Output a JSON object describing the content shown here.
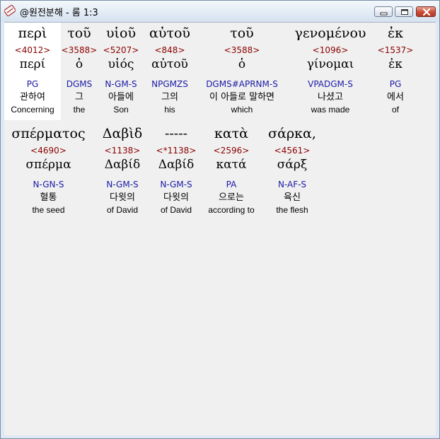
{
  "window": {
    "title": "@원전분해 - 롬 1:3"
  },
  "words_row1": [
    {
      "greek": "περὶ",
      "strong": "<4012>",
      "lemma": "περί",
      "parse": "PG",
      "korean": "관하여",
      "english": "Concerning"
    },
    {
      "greek": "τοῦ",
      "strong": "<3588>",
      "lemma": "ὁ",
      "parse": "DGMS",
      "korean": "그",
      "english": "the"
    },
    {
      "greek": "υἱοῦ",
      "strong": "<5207>",
      "lemma": "υἱός",
      "parse": "N-GM-S",
      "korean": "아들에",
      "english": "Son"
    },
    {
      "greek": "αὐτοῦ",
      "strong": "<848>",
      "lemma": "αὐτοῦ",
      "parse": "NPGMZS",
      "korean": "그의",
      "english": "his"
    },
    {
      "greek": "τοῦ",
      "strong": "<3588>",
      "lemma": "ὁ",
      "parse": "DGMS#APRNM-S",
      "korean": "이 아들로 말하면",
      "english": "which"
    },
    {
      "greek": "γενομένου",
      "strong": "<1096>",
      "lemma": "γίνομαι",
      "parse": "VPADGM-S",
      "korean": "나셨고",
      "english": "was made"
    },
    {
      "greek": "ἐκ",
      "strong": "<1537>",
      "lemma": "ἐκ",
      "parse": "PG",
      "korean": "에서",
      "english": "of"
    }
  ],
  "words_row2": [
    {
      "greek": "σπέρματος",
      "strong": "<4690>",
      "lemma": "σπέρμα",
      "parse": "N-GN-S",
      "korean": "혈통",
      "english": "the seed"
    },
    {
      "greek": "Δαβὶδ",
      "strong": "<1138>",
      "lemma": "Δαβίδ",
      "parse": "N-GM-S",
      "korean": "다윗의",
      "english": "of David"
    },
    {
      "greek": "-----",
      "strong": "<*1138>",
      "lemma": "Δαβίδ",
      "parse": "N-GM-S",
      "korean": "다윗의",
      "english": "of David"
    },
    {
      "greek": "κατὰ",
      "strong": "<2596>",
      "lemma": "κατά",
      "parse": "PA",
      "korean": "으로는",
      "english": "according to"
    },
    {
      "greek": "σάρκα,",
      "strong": "<4561>",
      "lemma": "σάρξ",
      "parse": "N-AF-S",
      "korean": "육신",
      "english": "the flesh"
    }
  ]
}
